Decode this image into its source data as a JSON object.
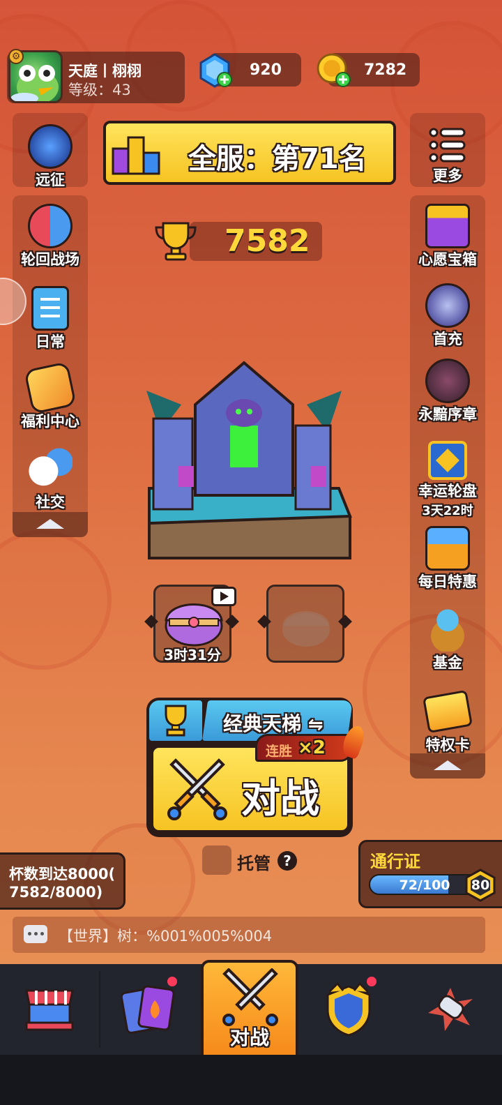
{
  "player": {
    "name": "天庭丨栩栩",
    "level_label": "等级：",
    "level": "43"
  },
  "resources": {
    "gems": "920",
    "coins": "7282"
  },
  "rank_banner": "全服：第71名",
  "trophies": "7582",
  "left_menu": [
    {
      "label": "远征",
      "icon": "sword-shield-icon"
    },
    {
      "label": "轮回战场",
      "icon": "battle-faces-icon"
    },
    {
      "label": "日常",
      "icon": "clipboard-icon"
    },
    {
      "label": "福利中心",
      "icon": "gift-fire-icon"
    },
    {
      "label": "社交",
      "icon": "chat-faces-icon"
    }
  ],
  "right_menu": [
    {
      "label": "更多",
      "icon": "menu-list-icon"
    },
    {
      "label": "心愿宝箱",
      "icon": "wish-chest-icon"
    },
    {
      "label": "首充",
      "icon": "cat-mask-icon"
    },
    {
      "label": "永黯序章",
      "icon": "boar-icon"
    },
    {
      "label": "幸运轮盘",
      "sublabel": "3天22时",
      "icon": "lucky-wheel-icon"
    },
    {
      "label": "每日特惠",
      "icon": "daily-gift-icon"
    },
    {
      "label": "基金",
      "icon": "money-bag-icon"
    },
    {
      "label": "特权卡",
      "icon": "privilege-card-icon"
    }
  ],
  "chest_slots": [
    {
      "timer": "3时31分",
      "state": "locked"
    },
    {
      "timer": "",
      "state": "empty"
    }
  ],
  "mode": {
    "label": "经典天梯",
    "swap_symbol": "⇋"
  },
  "battle": {
    "label": "对战",
    "streak_label": "连胜",
    "streak_mult": "×2"
  },
  "auto": {
    "label": "托管",
    "help": "?"
  },
  "task": {
    "line1": "杯数到达8000(",
    "line2": "7582/8000)"
  },
  "pass": {
    "label": "通行证",
    "progress_text": "72/100",
    "progress": 0.72,
    "level": "80"
  },
  "chat": {
    "text": "【世界】树：%001%005%004"
  },
  "bottom_nav": [
    {
      "label": "",
      "icon": "shop-icon",
      "badge": false
    },
    {
      "label": "",
      "icon": "cards-icon",
      "badge": true
    },
    {
      "label": "对战",
      "icon": "battle-swords-icon",
      "badge": false,
      "active": true
    },
    {
      "label": "",
      "icon": "clan-shield-icon",
      "badge": true
    },
    {
      "label": "",
      "icon": "event-icon",
      "badge": false
    }
  ],
  "colors": {
    "bg_top": "#d5553a",
    "bg_bottom": "#e99559",
    "gold": "#f6c322",
    "nav_bg": "#22252e",
    "pass_bar": "#3d8ee0"
  }
}
